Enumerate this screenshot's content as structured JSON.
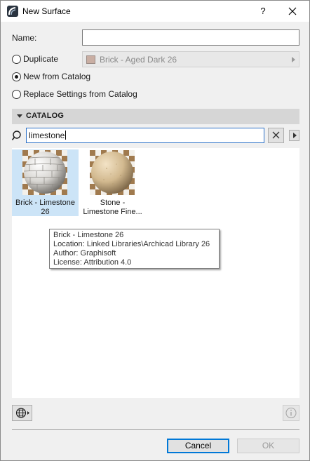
{
  "window": {
    "title": "New Surface",
    "help_label": "?"
  },
  "form": {
    "name_label": "Name:",
    "name_value": "",
    "duplicate_label": "Duplicate",
    "duplicate_value": "Brick - Aged Dark 26",
    "new_from_catalog_label": "New from Catalog",
    "replace_label": "Replace Settings from Catalog",
    "selected_option": "New from Catalog"
  },
  "catalog": {
    "header": "CATALOG",
    "search_value": "limestone",
    "items": [
      {
        "line1": "Brick - Limestone",
        "line2": "26",
        "selected": true
      },
      {
        "line1": "Stone -",
        "line2": "Limestone Fine...",
        "selected": false
      }
    ]
  },
  "tooltip": {
    "name": "Brick - Limestone 26",
    "location": "Location: Linked Libraries\\Archicad Library 26",
    "author": "Author: Graphisoft",
    "license": "License: Attribution 4.0"
  },
  "buttons": {
    "cancel": "Cancel",
    "ok": "OK"
  },
  "colors": {
    "accent": "#0078d7",
    "selection": "#cce4f7"
  }
}
